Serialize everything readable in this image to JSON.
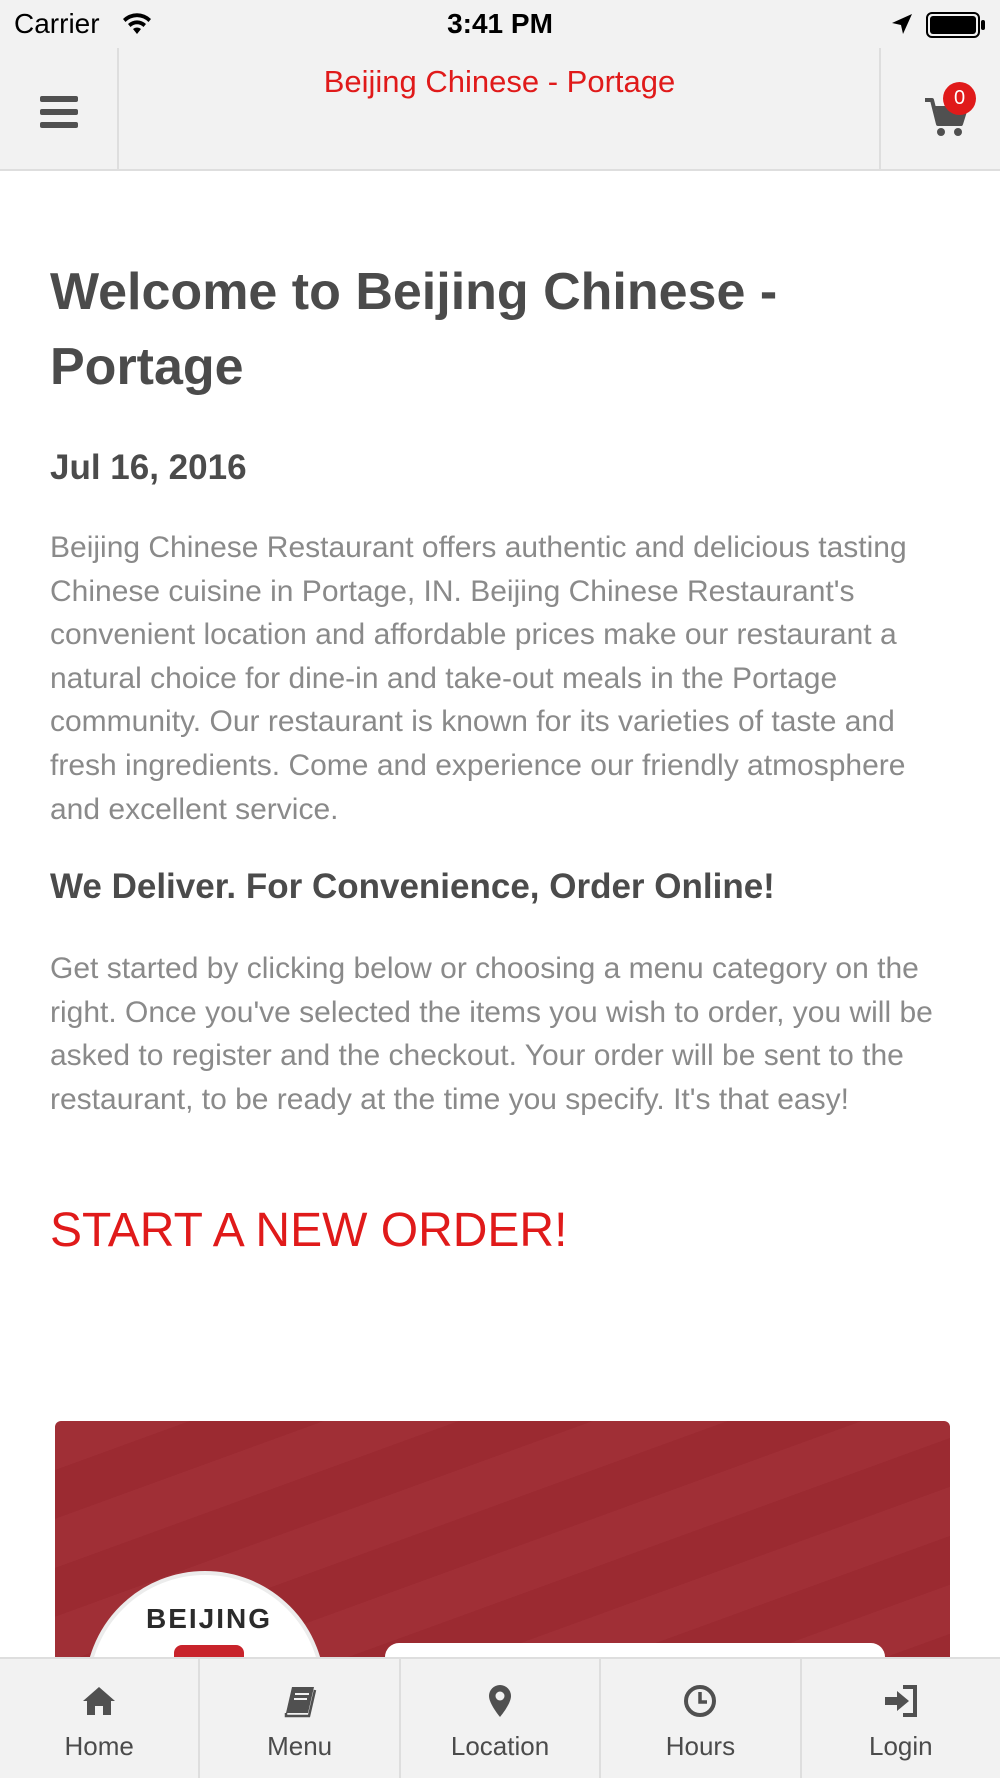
{
  "status_bar": {
    "carrier": "Carrier",
    "time": "3:41 PM"
  },
  "nav": {
    "title": "Beijing Chinese - Portage",
    "cart_count": "0"
  },
  "content": {
    "welcome_heading": "Welcome to Beijing Chinese - Portage",
    "date": "Jul 16, 2016",
    "intro": "Beijing Chinese Restaurant offers authentic and delicious tasting Chinese cuisine in Portage, IN. Beijing Chinese Restaurant's convenient location and affordable prices make our restaurant a natural choice for dine-in and take-out meals in the Portage community. Our restaurant is known for its varieties of taste and fresh ingredients. Come and experience our friendly atmosphere and excellent service.",
    "deliver_heading": "We Deliver. For Convenience, Order Online!",
    "instructions": "Get started by clicking below or choosing a menu category on the right. Once you've selected the items you wish to order, you will be asked to register and the checkout. Your order will be sent to the restaurant, to be ready at the time you specify. It's that easy!",
    "start_order": "START A NEW ORDER!"
  },
  "banner": {
    "logo_text": "BEIJING"
  },
  "tabs": [
    {
      "label": "Home",
      "icon": "home-icon"
    },
    {
      "label": "Menu",
      "icon": "book-icon"
    },
    {
      "label": "Location",
      "icon": "map-pin-icon"
    },
    {
      "label": "Hours",
      "icon": "clock-icon"
    },
    {
      "label": "Login",
      "icon": "sign-in-icon"
    }
  ],
  "colors": {
    "accent": "#e01a1a",
    "heading": "#4b4b4b",
    "body_text": "#8a8a8a",
    "bar_background": "#f2f2f2",
    "banner_red": "#a02f36"
  }
}
